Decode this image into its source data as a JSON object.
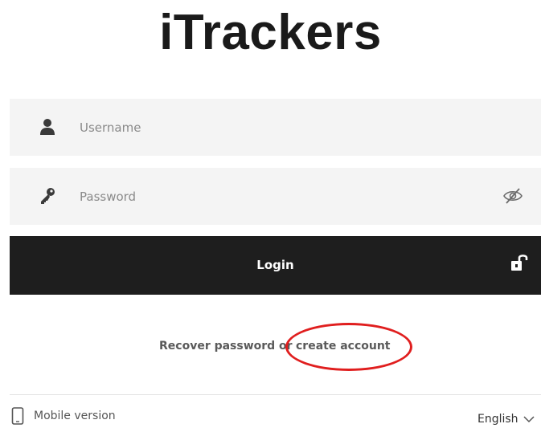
{
  "app": {
    "title": "iTrackers"
  },
  "form": {
    "username": {
      "placeholder": "Username",
      "value": "",
      "icon": "user-icon"
    },
    "password": {
      "placeholder": "Password",
      "value": "",
      "icon": "key-icon",
      "toggle_icon": "eye-slash-icon"
    },
    "login": {
      "label": "Login",
      "icon": "unlock-icon"
    }
  },
  "links": {
    "recover": "Recover password",
    "or": "or",
    "create": "create account",
    "highlight_color": "#e01e1e"
  },
  "footer": {
    "mobile": {
      "label": "Mobile version",
      "icon": "mobile-phone-icon"
    },
    "language": {
      "selected": "English",
      "icon": "chevron-down-icon"
    }
  },
  "colors": {
    "button_bg": "#1e1e1e",
    "field_bg": "#f4f4f4",
    "text_muted": "#8a8a8a"
  }
}
